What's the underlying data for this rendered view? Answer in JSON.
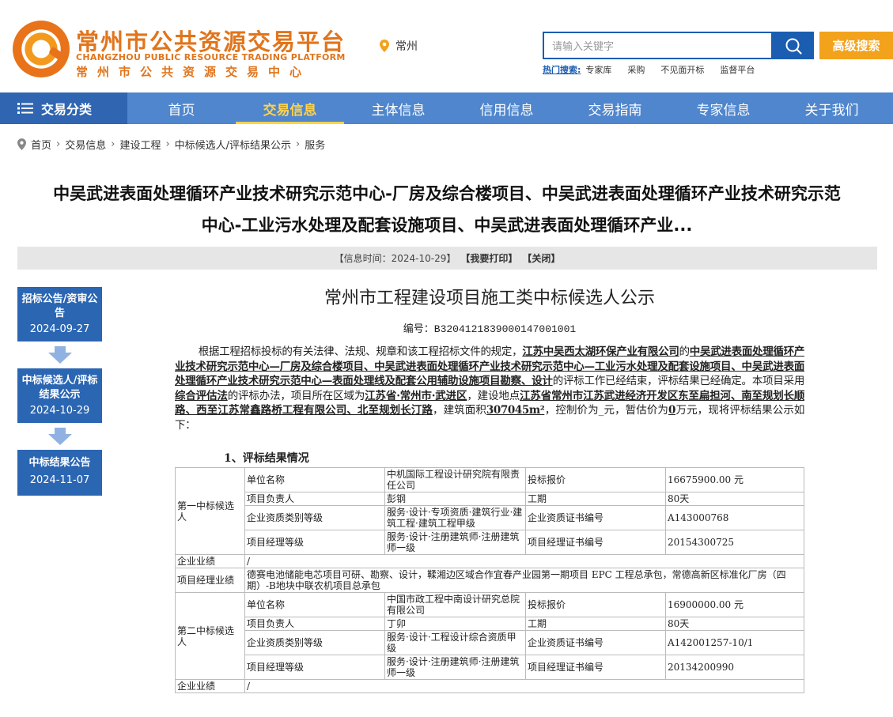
{
  "brand": {
    "name_cn": "常州市公共资源交易平台",
    "name_en": "CHANGZHOU PUBLIC RESOURCE TRADING PLATFORM",
    "subtitle": "常州市公共资源交易中心",
    "colors": {
      "orange": "#e1751c",
      "blue": "#1a5db1",
      "nav": "#4f86cd"
    }
  },
  "location": {
    "icon": "location-pin-icon",
    "city": "常州"
  },
  "search": {
    "placeholder": "请输入关键字",
    "button_icon": "search-icon",
    "advanced_label": "高级搜索"
  },
  "hot_search": {
    "label": "热门搜索:",
    "items": [
      "专家库",
      "采购",
      "不见面开标",
      "监督平台"
    ]
  },
  "nav": {
    "category_label": "交易分类",
    "category_icon": "menu-icon",
    "items": [
      "首页",
      "交易信息",
      "主体信息",
      "信用信息",
      "交易指南",
      "专家信息",
      "关于我们"
    ],
    "active_index": 1
  },
  "breadcrumb": [
    "首页",
    "交易信息",
    "建设工程",
    "中标候选人/评标结果公示",
    "服务"
  ],
  "page_title_line1": "中吴武进表面处理循环产业技术研究示范中心-厂房及综合楼项目、中吴武进表面处理循环产业技术研究示范",
  "page_title_line2": "中心-工业污水处理及配套设施项目、中吴武进表面处理循环产业...",
  "info_bar": {
    "time": "【信息时间：2024-10-29】",
    "print": "【我要打印】",
    "close": "【关闭】"
  },
  "timeline": [
    {
      "label": "招标公告/资审公告",
      "date": "2024-09-27"
    },
    {
      "label": "中标候选人/评标结果公示",
      "date": "2024-10-29"
    },
    {
      "label": "中标结果公告",
      "date": "2024-11-07"
    }
  ],
  "document": {
    "title": "常州市工程建设项目施工类中标候选人公示",
    "number": "编号：B3204121839000147001001",
    "para_1": "根据工程招标投标的有关法律、法规、规章和该工程招标文件的规定，",
    "bidder": "江苏中吴西太湖环保产业有限公司",
    "para_2": "的",
    "project": "中吴武进表面处理循环产业技术研究示范中心—厂房及综合楼项目、中吴武进表面处理循环产业技术研究示范中心—工业污水处理及配套设施项目、中吴武进表面处理循环产业技术研究示范中心—表面处理线及配套公用辅助设施项目勘察、设计",
    "para_3": "的评标工作已经结束，评标结果已经确定。本项目采用",
    "method": "综合评估法",
    "para_4": "的评标办法，项目所在区域为",
    "region": "江苏省·常州市·武进区",
    "para_5": "，建设地点",
    "site": "江苏省常州市江苏武进经济开发区东至扁担河、南至规划长顺路、西至江苏常鑫路桥工程有限公司、北至规划长汀路",
    "para_6": "，建筑面积",
    "area": "307045m²",
    "para_7": "，控制价为_元，暂估价为",
    "estimate": "0",
    "para_8": "万元，现将评标结果公示如下：",
    "section_1": "1、评标结果情况"
  },
  "table": {
    "labels": {
      "unit": "单位名称",
      "bid_price": "投标报价",
      "manager": "项目负责人",
      "duration": "工期",
      "qual_level": "企业资质类别等级",
      "qual_cert": "企业资质证书编号",
      "pm_level": "项目经理等级",
      "pm_cert": "项目经理证书编号",
      "company_perf": "企业业绩",
      "pm_perf": "项目经理业绩"
    },
    "candidates": [
      {
        "rank": "第一中标候选人",
        "unit": "中机国际工程设计研究院有限责任公司",
        "bid_price": "16675900.00 元",
        "manager": "彭钢",
        "duration": "80天",
        "qual_level": "服务·设计·专项资质·建筑行业·建筑工程·建筑工程甲级",
        "qual_cert": "A143000768",
        "pm_level": "服务·设计·注册建筑师·注册建筑师一级",
        "pm_cert": "20154300725",
        "company_perf": "/",
        "pm_perf": "德赛电池储能电芯项目可研、勘察、设计，鞣湘边区域合作宜春产业园第一期项目 EPC 工程总承包，常德高新区标准化厂房（四期）-B地块中联农机项目总承包"
      },
      {
        "rank": "第二中标候选人",
        "unit": "中国市政工程中南设计研究总院有限公司",
        "bid_price": "16900000.00 元",
        "manager": "丁卯",
        "duration": "80天",
        "qual_level": "服务·设计·工程设计综合资质甲级",
        "qual_cert": "A142001257-10/1",
        "pm_level": "服务·设计·注册建筑师·注册建筑师一级",
        "pm_cert": "20134200990",
        "company_perf": "/"
      }
    ]
  }
}
